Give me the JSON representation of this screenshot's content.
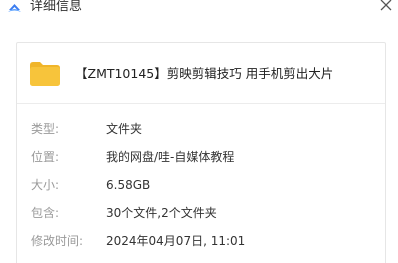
{
  "window": {
    "title": "详细信息"
  },
  "file": {
    "name": "【ZMT10145】剪映剪辑技巧 用手机剪出大片",
    "icon": "folder-icon"
  },
  "details": [
    {
      "label": "类型:",
      "value": "文件夹"
    },
    {
      "label": "位置:",
      "value": "我的网盘/哇-自媒体教程"
    },
    {
      "label": "大小:",
      "value": "6.58GB"
    },
    {
      "label": "包含:",
      "value": "30个文件,2个文件夹"
    },
    {
      "label": "修改时间:",
      "value": "2024年04月07日, 11:01"
    }
  ],
  "colors": {
    "app_icon": "#3b7cf0",
    "folder": "#f7c43b",
    "folder_tab": "#f0b52a",
    "label": "#9a9a9a",
    "value": "#333333"
  }
}
